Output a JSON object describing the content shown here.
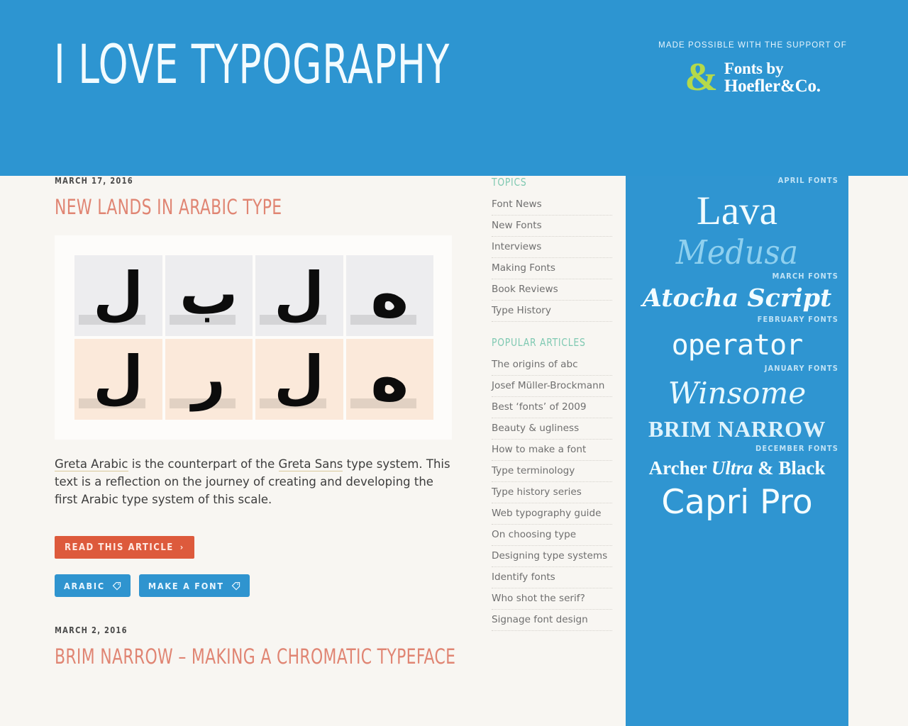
{
  "header": {
    "site_title": "I LOVE TYPOGRAPHY",
    "sponsor_kicker": "MADE POSSIBLE WITH THE SUPPORT OF",
    "sponsor_amp": "&",
    "sponsor_line1": "Fonts by",
    "sponsor_line2": "Hoefler&Co.",
    "bg_color": "#2d95d1",
    "accent_green": "#b4d94a"
  },
  "posts": [
    {
      "date": "MARCH 17, 2016",
      "title": "NEW LANDS IN ARABIC TYPE",
      "figure_alt": "Arabic letterform grid",
      "figure_glyphs": [
        "ل",
        "ب",
        "ل",
        "ه",
        "ل",
        "ر",
        "ل",
        "ه"
      ],
      "excerpt_parts": {
        "link1": "Greta Arabic",
        "mid1": " is the counterpart of the ",
        "link2": "Greta Sans",
        "tail": " type system. This text is a reflection on the journey of creating and developing the first Arabic type system of this scale."
      },
      "read_label": "READ THIS ARTICLE",
      "read_chevron": "›",
      "tags": [
        "ARABIC",
        "MAKE A FONT"
      ]
    },
    {
      "date": "MARCH 2, 2016",
      "title": "BRIM NARROW – MAKING A CHROMATIC TYPEFACE"
    }
  ],
  "sidebar": {
    "topics_heading": "TOPICS",
    "topics": [
      "Font News",
      "New Fonts",
      "Interviews",
      "Making Fonts",
      "Book Reviews",
      "Type History"
    ],
    "popular_heading": "POPULAR ARTICLES",
    "popular": [
      "The origins of abc",
      "Josef Müller-Brockmann",
      "Best ‘fonts’ of 2009",
      "Beauty & ugliness",
      "How to make a font",
      "Type terminology",
      "Type history series",
      "Web typography guide",
      "On choosing type",
      "Designing type systems",
      "Identify fonts",
      "Who shot the serif?",
      "Signage font design"
    ],
    "heading_color": "#7fc9b2"
  },
  "promo": {
    "bg_color": "#2f95d1",
    "labels": {
      "april": "APRIL FONTS",
      "march": "MARCH FONTS",
      "february": "FEBRUARY FONTS",
      "january": "JANUARY FONTS",
      "december": "DECEMBER FONTS"
    },
    "fonts": {
      "lava": "Lava",
      "medusa": "Medusa",
      "atocha": "Atocha Script",
      "operator": "operator",
      "winsome": "Winsome",
      "brim": "BRIM NARROW",
      "archer_a": "Archer ",
      "archer_b": "Ultra",
      "archer_c": " & Black",
      "capri": "Capri Pro"
    }
  },
  "theme": {
    "page_bg": "#f8f6f2",
    "title_color": "#e08573",
    "button_orange": "#dd5a3c",
    "button_blue": "#2f94cf"
  }
}
